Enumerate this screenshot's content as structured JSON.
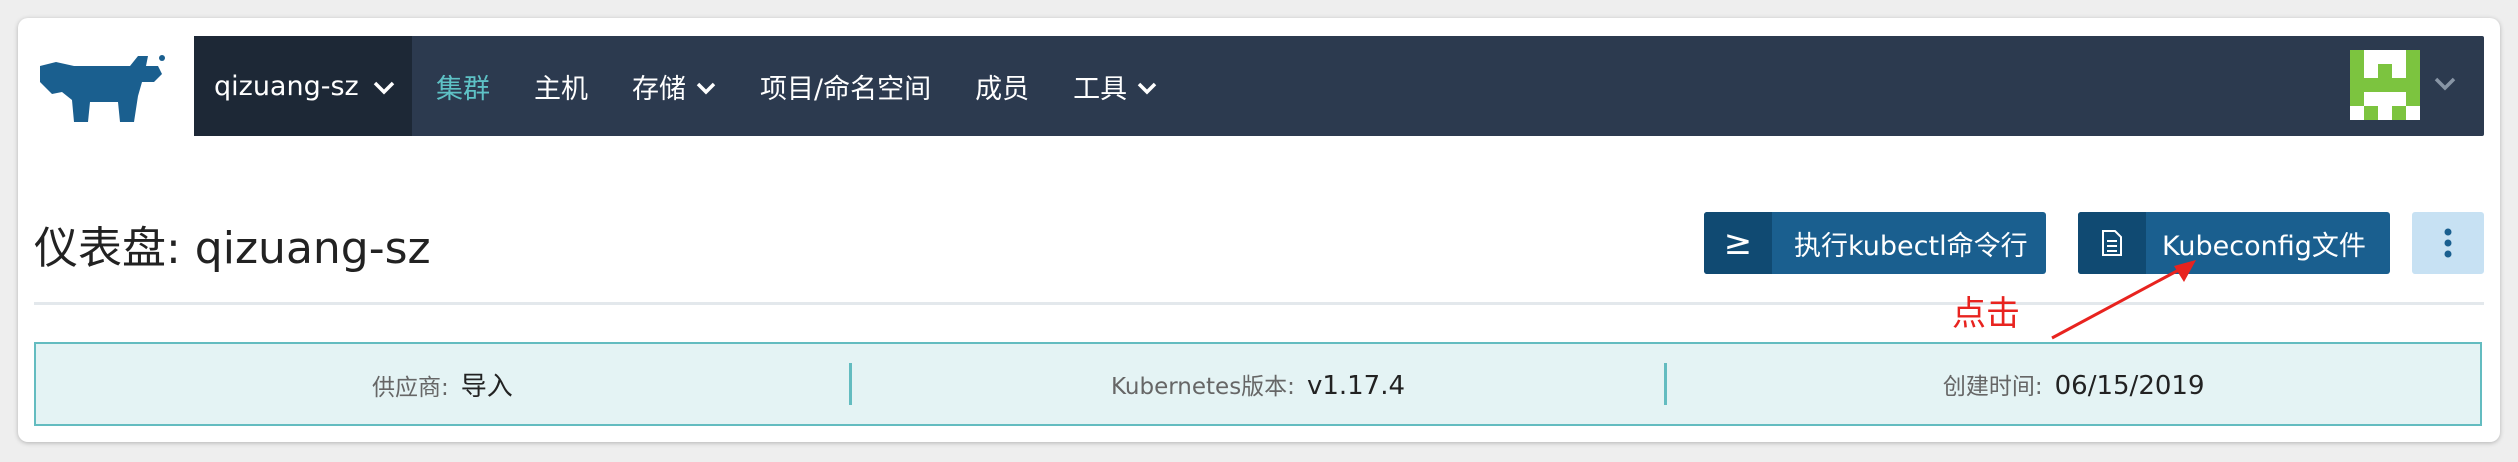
{
  "nav": {
    "cluster_name": "qizuang-sz",
    "items": [
      {
        "label": "集群",
        "active": true,
        "dropdown": false
      },
      {
        "label": "主机",
        "active": false,
        "dropdown": false
      },
      {
        "label": "存储",
        "active": false,
        "dropdown": true
      },
      {
        "label": "项目/命名空间",
        "active": false,
        "dropdown": false
      },
      {
        "label": "成员",
        "active": false,
        "dropdown": false
      },
      {
        "label": "工具",
        "active": false,
        "dropdown": true
      }
    ],
    "logo_icon": "rancher-cow-logo",
    "avatar_icon": "user-avatar-icon"
  },
  "page": {
    "title": "仪表盘: qizuang-sz"
  },
  "buttons": {
    "kubectl_icon": "≥",
    "kubectl_label": "执行kubectl命令行",
    "kubeconfig_icon": "file-icon",
    "kubeconfig_label": "Kubeconfig文件",
    "more_icon": "vertical-ellipsis-icon"
  },
  "info": {
    "provider_label": "供应商:",
    "provider_value": "导入",
    "k8s_label": "Kubernetes版本:",
    "k8s_value": "v1.17.4",
    "created_label": "创建时间:",
    "created_value": "06/15/2019"
  },
  "annotation": {
    "text": "点击"
  },
  "colors": {
    "navbar": "#2c3a4f",
    "cluster_bg": "#1d2836",
    "active_nav": "#5ec2c6",
    "button": "#1a5f8f",
    "annotation": "#e8231f",
    "info_bg": "#e4f3f4",
    "info_border": "#63bcc0"
  }
}
